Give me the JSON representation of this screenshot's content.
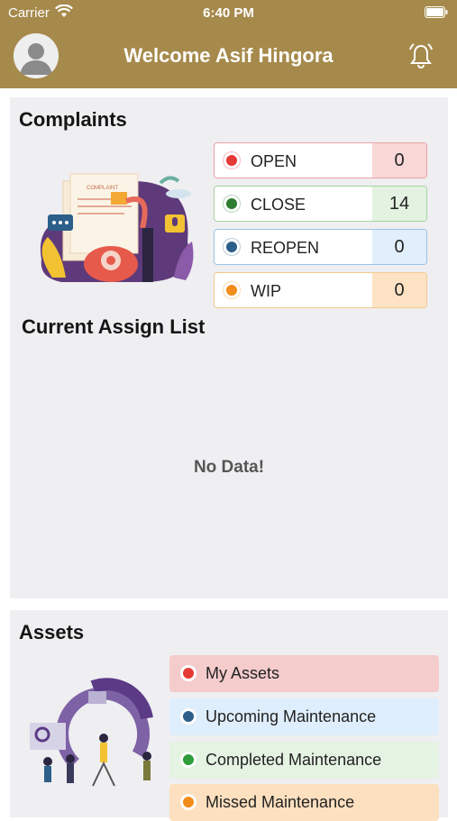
{
  "status_bar": {
    "carrier": "Carrier",
    "time": "6:40 PM"
  },
  "header": {
    "title": "Welcome Asif Hingora",
    "bg_color": "#a68a4c"
  },
  "complaints": {
    "title": "Complaints",
    "illustration": "complaint-phone-illustration",
    "illustration_text": "COMPLAINT",
    "statuses": [
      {
        "label": "OPEN",
        "count": "0",
        "dot_color": "#e53935",
        "count_bg": "#f8d7d7",
        "border": "#e8a4a4"
      },
      {
        "label": "CLOSE",
        "count": "14",
        "dot_color": "#2e7d32",
        "count_bg": "#e3f2e1",
        "border": "#a6d4a0"
      },
      {
        "label": "REOPEN",
        "count": "0",
        "dot_color": "#2c5f8a",
        "count_bg": "#e1eefb",
        "border": "#9ec2e4"
      },
      {
        "label": "WIP",
        "count": "0",
        "dot_color": "#f28c1b",
        "count_bg": "#fde3c3",
        "border": "#f2c98e"
      }
    ]
  },
  "assign_list": {
    "title": "Current Assign List",
    "empty_text": "No Data!"
  },
  "assets": {
    "title": "Assets",
    "illustration": "maintenance-team-illustration",
    "items": [
      {
        "label": "My Assets",
        "dot_color": "#e53935",
        "bg": "#f4cccc"
      },
      {
        "label": "Upcoming Maintenance",
        "dot_color": "#2c5f8a",
        "bg": "#dfeefc"
      },
      {
        "label": "Completed Maintenance",
        "dot_color": "#2e9d3a",
        "bg": "#e4f3e2"
      },
      {
        "label": "Missed Maintenance",
        "dot_color": "#f28c1b",
        "bg": "#fde0bf"
      }
    ]
  }
}
